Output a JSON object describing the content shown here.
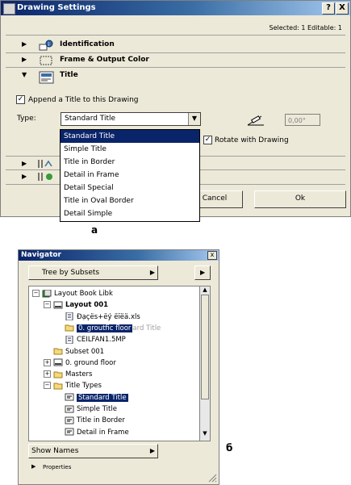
{
  "dialog": {
    "title": "Drawing Settings",
    "help_label": "?",
    "close_label": "X",
    "selected_info": "Selected: 1 Editable: 1",
    "sections": [
      {
        "label": "Identification",
        "arrow": "▶"
      },
      {
        "label": "Frame & Output Color",
        "arrow": "▶"
      },
      {
        "label": "Title",
        "arrow": "▼"
      }
    ],
    "append_title_label": "Append a Title to this Drawing",
    "append_title_checked": "✓",
    "type_label": "Type:",
    "type_value": "Standard Title",
    "dropdown_arrow": "▼",
    "type_options": [
      "Standard Title",
      "Simple Title",
      "Title in Border",
      "Detail in Frame",
      "Detail Special",
      "Title in Oval Border",
      "Detail Simple"
    ],
    "angle_value": "0,00°",
    "rotate_label": "Rotate with Drawing",
    "rotate_checked": "✓",
    "cancel_label": "Cancel",
    "ok_label": "Ok"
  },
  "caption_a": "a",
  "caption_b": "б",
  "navigator": {
    "title": "Navigator",
    "close_label": "x",
    "view_mode": "Tree by Subsets",
    "combo_arrow": "▶",
    "tree": [
      {
        "label": "Layout Book Libk",
        "indent": 0,
        "expander": "−",
        "icon": "book"
      },
      {
        "label": "Layout 001",
        "indent": 1,
        "expander": "−",
        "icon": "layout",
        "bold": true
      },
      {
        "label": "Đạçëѕ+ëý ëïëä.xls",
        "indent": 2,
        "icon": "file"
      },
      {
        "label": "0. groutfic floor",
        "indent": 2,
        "icon": "folder",
        "selected": true,
        "suffix": "ard Title"
      },
      {
        "label": "CEILFAN1.5MP",
        "indent": 2,
        "icon": "file"
      },
      {
        "label": "Subset 001",
        "indent": 1,
        "icon": "folder"
      },
      {
        "label": "0. ground floor",
        "indent": 1,
        "expander": "+",
        "icon": "layout"
      },
      {
        "label": "Masters",
        "indent": 1,
        "expander": "+",
        "icon": "folder"
      },
      {
        "label": "Title Types",
        "indent": 1,
        "expander": "−",
        "icon": "folder"
      },
      {
        "label": "Standard Title",
        "indent": 2,
        "icon": "title",
        "selected": true
      },
      {
        "label": "Simple Title",
        "indent": 2,
        "icon": "title"
      },
      {
        "label": "Title in Border",
        "indent": 2,
        "icon": "title"
      },
      {
        "label": "Detail in Frame",
        "indent": 2,
        "icon": "title"
      }
    ],
    "show_names": "Show Names",
    "properties_label": "Properties",
    "properties_arrow": "▶"
  }
}
